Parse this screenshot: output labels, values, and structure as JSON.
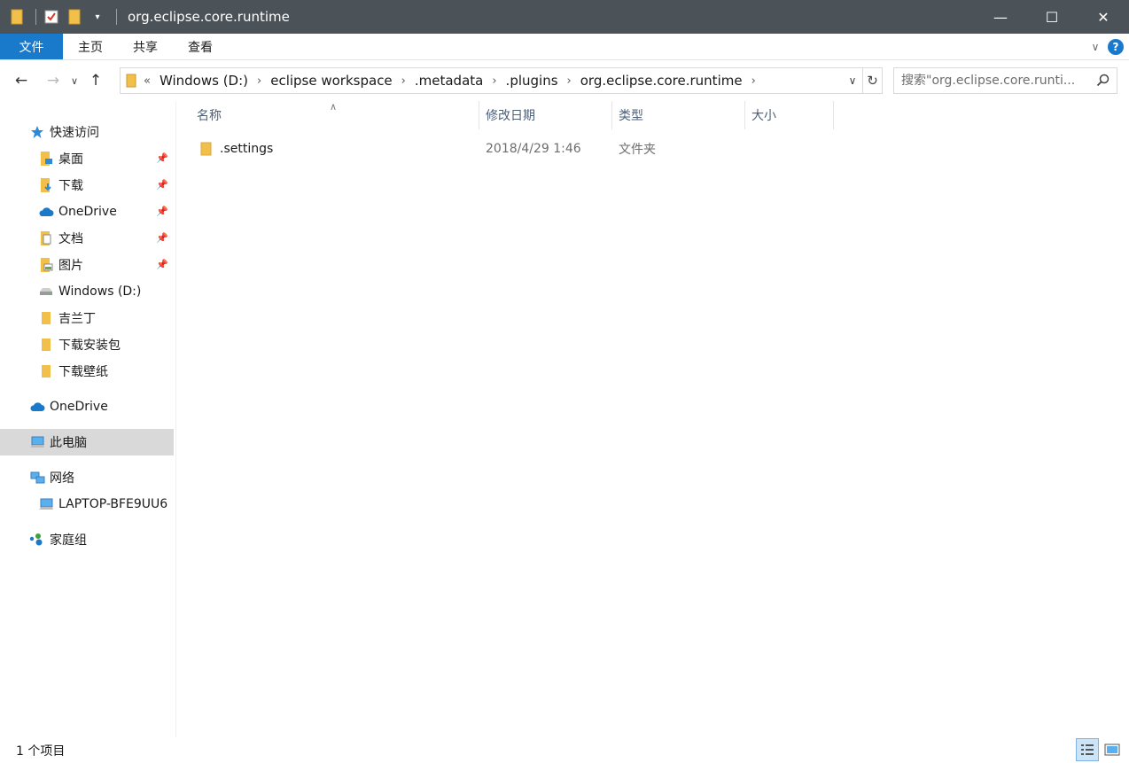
{
  "window": {
    "title": "org.eclipse.core.runtime",
    "controls": {
      "minimize": "—",
      "maximize": "☐",
      "close": "✕"
    }
  },
  "ribbon": {
    "tabs": [
      {
        "label": "文件",
        "active": true
      },
      {
        "label": "主页"
      },
      {
        "label": "共享"
      },
      {
        "label": "查看"
      }
    ],
    "help_label": "?"
  },
  "address_bar": {
    "overflow": "«",
    "breadcrumbs": [
      "Windows (D:)",
      "eclipse workspace",
      ".metadata",
      ".plugins",
      "org.eclipse.core.runtime"
    ]
  },
  "search": {
    "placeholder": "搜索\"org.eclipse.core.runti..."
  },
  "nav_pane": {
    "quick_access": "快速访问",
    "pinned": [
      "桌面",
      "下载",
      "OneDrive",
      "文档",
      "图片"
    ],
    "recent": [
      "Windows (D:)",
      "吉兰丁",
      "下载安装包",
      "下载壁纸"
    ],
    "onedrive": "OneDrive",
    "this_pc": "此电脑",
    "network": "网络",
    "network_device": "LAPTOP-BFE9UU6",
    "homegroup": "家庭组"
  },
  "file_list": {
    "columns": [
      "名称",
      "修改日期",
      "类型",
      "大小"
    ],
    "rows": [
      {
        "name": ".settings",
        "modified": "2018/4/29 1:46",
        "type": "文件夹",
        "size": ""
      }
    ]
  },
  "status": {
    "item_count": "1 个项目"
  },
  "colors": {
    "accent": "#1979ca",
    "titlebar": "#4b5258",
    "folder": "#f2c04a"
  }
}
